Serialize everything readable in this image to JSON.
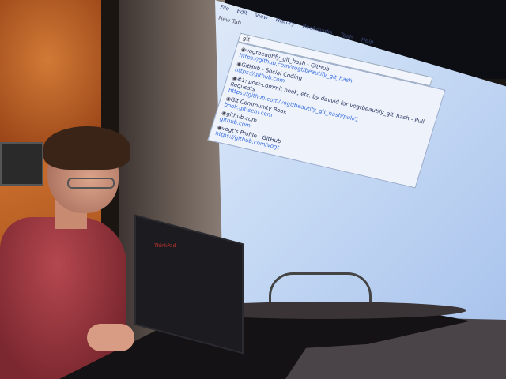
{
  "scene": "presenter at podium with laptop in front of projected browser",
  "browser": {
    "menu": [
      "File",
      "Edit",
      "View",
      "History",
      "Bookmarks",
      "Tools",
      "Help"
    ],
    "tab": "New Tab",
    "search_value": "git",
    "results": [
      {
        "title": "vogtbeautify_git_hash - GitHub",
        "url": "https://github.com/vogt/beautify_git_hash"
      },
      {
        "title": "GitHub - Social Coding",
        "url": "https://github.com"
      },
      {
        "title": "#1: post-commit hook, etc. by davvid for vogtbeautify_git_hash - Pull Requests",
        "url": "https://github.com/vogt/beautify_git_hash/pull/1"
      },
      {
        "title": "Git Community Book",
        "url": "book.git-scm.com"
      },
      {
        "title": "github.com",
        "url": "github.com"
      },
      {
        "title": "vogt's Profile - GitHub",
        "url": "https://github.com/vogt"
      }
    ]
  },
  "laptop": {
    "logo": "ThinkPad"
  }
}
